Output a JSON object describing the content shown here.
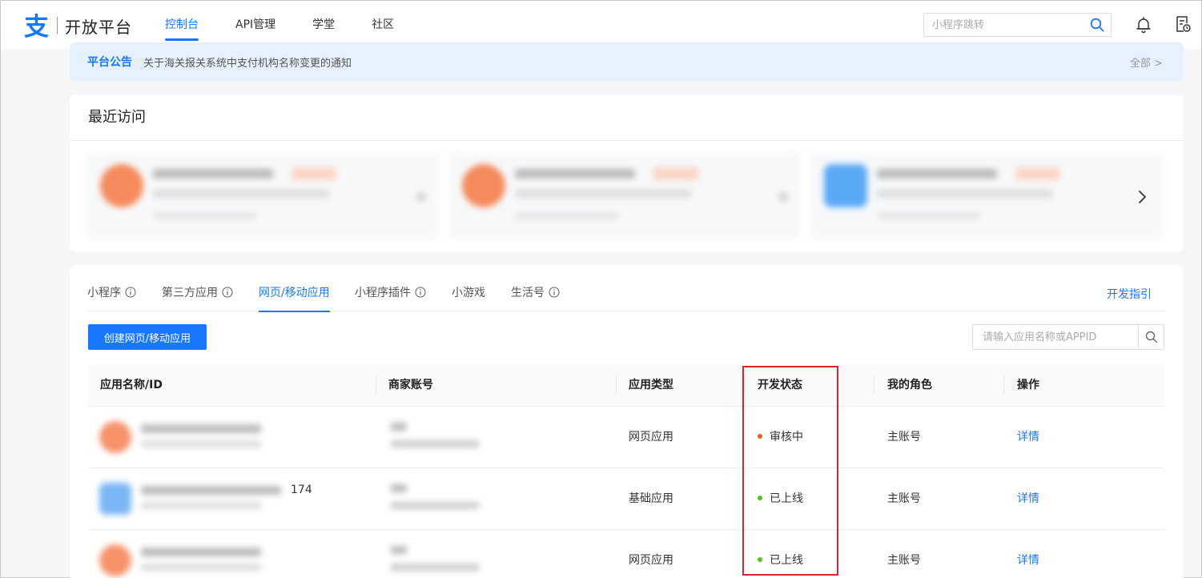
{
  "header": {
    "logo_glyph": "支",
    "logo_text": "开放平台",
    "nav": [
      {
        "label": "控制台",
        "active": true
      },
      {
        "label": "API管理",
        "active": false
      },
      {
        "label": "学堂",
        "active": false
      },
      {
        "label": "社区",
        "active": false
      }
    ],
    "search_placeholder": "小程序跳转",
    "icons": [
      "search-icon",
      "bell-icon",
      "document-icon"
    ]
  },
  "notice": {
    "title": "平台公告",
    "text": "关于海关报关系统中支付机构名称变更的通知",
    "more": "全部 >"
  },
  "recent": {
    "title": "最近访问",
    "next_icon": "chevron-right-icon"
  },
  "apps": {
    "tabs": [
      {
        "label": "小程序",
        "info": true,
        "active": false
      },
      {
        "label": "第三方应用",
        "info": true,
        "active": false
      },
      {
        "label": "网页/移动应用",
        "info": false,
        "active": true
      },
      {
        "label": "小程序插件",
        "info": true,
        "active": false
      },
      {
        "label": "小游戏",
        "info": false,
        "active": false
      },
      {
        "label": "生活号",
        "info": true,
        "active": false
      }
    ],
    "guide": "开发指引",
    "create_button": "创建网页/移动应用",
    "search_placeholder": "请输入应用名称或APPID",
    "columns": [
      "应用名称/ID",
      "商家账号",
      "应用类型",
      "开发状态",
      "我的角色",
      "操作"
    ],
    "rows": [
      {
        "id_suffix": "",
        "type": "网页应用",
        "status": "审核中",
        "status_color": "#f05a22",
        "role": "主账号",
        "action": "详情"
      },
      {
        "id_suffix": "174",
        "type": "基础应用",
        "status": "已上线",
        "status_color": "#52c41a",
        "role": "主账号",
        "action": "详情"
      },
      {
        "id_suffix": "",
        "type": "网页应用",
        "status": "已上线",
        "status_color": "#52c41a",
        "role": "主账号",
        "action": "详情"
      }
    ]
  },
  "colors": {
    "accent": "#1677ff",
    "highlight_box": "#d9262c"
  }
}
